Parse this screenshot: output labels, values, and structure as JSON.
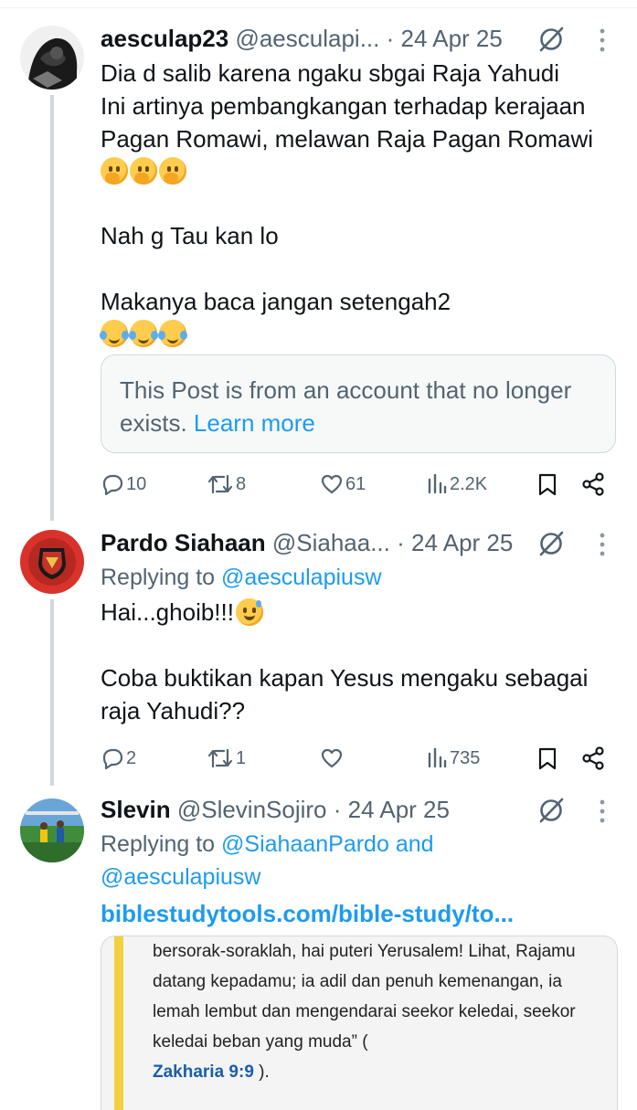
{
  "posts": [
    {
      "name": "aesculap23",
      "handle": "@aesculapi...",
      "date": "24 Apr 25",
      "replying_prefix": "",
      "replying_to": "",
      "text_top": "Dia d salib karena ngaku sbgai Raja Yahudi\nIni artinya pembangkangan terhadap kerajaan\nPagan Romawi, melawan Raja Pagan Romawi",
      "emoji_row_1": [
        "hand-over-mouth-emoji",
        "hand-over-mouth-emoji",
        "hand-over-mouth-emoji"
      ],
      "text_middle": "Nah  g Tau kan lo",
      "text_bottom": "Makanya baca jangan setengah2",
      "emoji_row_2": [
        "rolling-laughing-emoji",
        "rolling-laughing-emoji",
        "rolling-laughing-emoji"
      ],
      "notice_text": "This Post is from an account that no longer exists.",
      "notice_link": "Learn more",
      "replies": "10",
      "reposts": "8",
      "likes": "61",
      "views": "2.2K"
    },
    {
      "name": "Pardo Siahaan",
      "handle": "@Siahaa...",
      "date": "24 Apr 25",
      "replying_prefix": "Replying to",
      "replying_to": "@aesculapiusw",
      "text_top": "Hai...ghoib!!!",
      "emoji": "grinning-sweat-emoji",
      "text_bottom": "Coba buktikan kapan Yesus mengaku sebagai\nraja Yahudi??",
      "replies": "2",
      "reposts": "1",
      "likes": "",
      "views": "735"
    },
    {
      "name": "Slevin",
      "handle": "@SlevinSojiro",
      "date": "24 Apr 25",
      "replying_prefix": "Replying to",
      "replying_to_1": "@SiahaanPardo",
      "replying_and": "and",
      "replying_to_2": "@aesculapiusw",
      "link": "biblestudytools.com/bible-study/to...",
      "image_text": "bersorak-soraklah, hai puteri Yerusalem! Lihat, Rajamu datang kepadamu; ia adil dan penuh kemenangan, ia lemah lembut dan mengendarai seekor keledai, seekor keledai beban yang muda” (",
      "image_ref": "Zakharia 9:9",
      "image_tail": " )."
    }
  ],
  "colors": {
    "text": "#0f1419",
    "secondary": "#536471",
    "link": "#1d9bf0",
    "thread_line": "#cfd9de"
  }
}
